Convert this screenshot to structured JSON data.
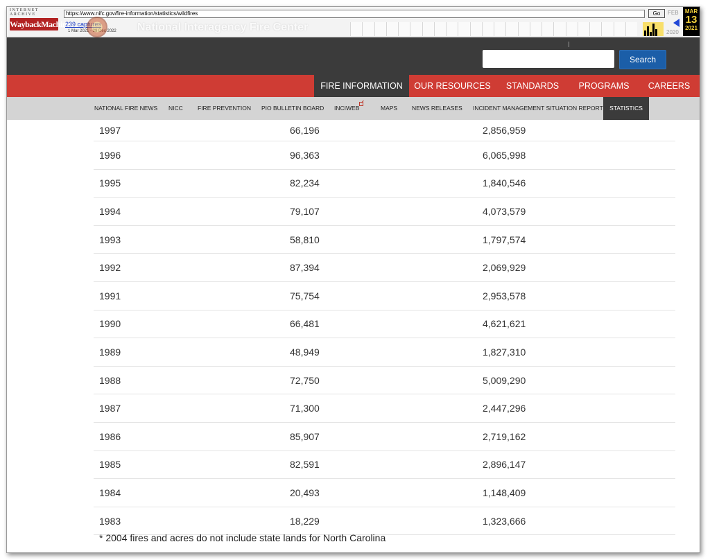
{
  "wayback": {
    "logo_top": "INTERNET ARCHIVE",
    "logo_main": "WaybackMachine",
    "url": "https://www.nifc.gov/fire-information/statistics/wildfires",
    "go_label": "Go",
    "captures": "239 captures",
    "date_range": "1 Mar 2021 - 29 Dec 2022",
    "prev_month": "FEB",
    "cur_month": "MAR",
    "cur_day": "13",
    "cur_year": "2021",
    "prev_year": "2020"
  },
  "site": {
    "title": "National Interagency Fire Center"
  },
  "header": {
    "search_placeholder": "",
    "search_button": "Search"
  },
  "nav": {
    "items": [
      {
        "label": "FIRE INFORMATION",
        "active": true
      },
      {
        "label": "OUR RESOURCES"
      },
      {
        "label": "STANDARDS"
      },
      {
        "label": "PROGRAMS"
      },
      {
        "label": "CAREERS"
      }
    ]
  },
  "subnav": {
    "items": [
      {
        "label": "NATIONAL FIRE NEWS"
      },
      {
        "label": "NICC"
      },
      {
        "label": "FIRE PREVENTION"
      },
      {
        "label": "PIO BULLETIN BOARD"
      },
      {
        "label": "INCIWEB"
      },
      {
        "label": "MAPS"
      },
      {
        "label": "NEWS RELEASES"
      },
      {
        "label": "INCIDENT MANAGEMENT SITUATION REPORT"
      },
      {
        "label": "STATISTICS",
        "active": true
      }
    ]
  },
  "table": {
    "rows": [
      {
        "year": "1997",
        "fires": "66,196",
        "acres": "2,856,959"
      },
      {
        "year": "1996",
        "fires": "96,363",
        "acres": "6,065,998"
      },
      {
        "year": "1995",
        "fires": "82,234",
        "acres": "1,840,546"
      },
      {
        "year": "1994",
        "fires": "79,107",
        "acres": "4,073,579"
      },
      {
        "year": "1993",
        "fires": "58,810",
        "acres": "1,797,574"
      },
      {
        "year": "1992",
        "fires": "87,394",
        "acres": "2,069,929"
      },
      {
        "year": "1991",
        "fires": "75,754",
        "acres": "2,953,578"
      },
      {
        "year": "1990",
        "fires": "66,481",
        "acres": "4,621,621"
      },
      {
        "year": "1989",
        "fires": "48,949",
        "acres": "1,827,310"
      },
      {
        "year": "1988",
        "fires": "72,750",
        "acres": "5,009,290"
      },
      {
        "year": "1987",
        "fires": "71,300",
        "acres": "2,447,296"
      },
      {
        "year": "1986",
        "fires": "85,907",
        "acres": "2,719,162"
      },
      {
        "year": "1985",
        "fires": "82,591",
        "acres": "2,896,147"
      },
      {
        "year": "1984",
        "fires": "20,493",
        "acres": "1,148,409"
      },
      {
        "year": "1983",
        "fires": "18,229",
        "acres": "1,323,666"
      }
    ],
    "footnote": "* 2004 fires and acres do not include state lands for North Carolina"
  },
  "colors": {
    "nav_red": "#cf3c34",
    "header_dark": "#3b3b3b",
    "search_blue": "#1b5ea8",
    "subnav_gray": "#d4d4d4"
  }
}
